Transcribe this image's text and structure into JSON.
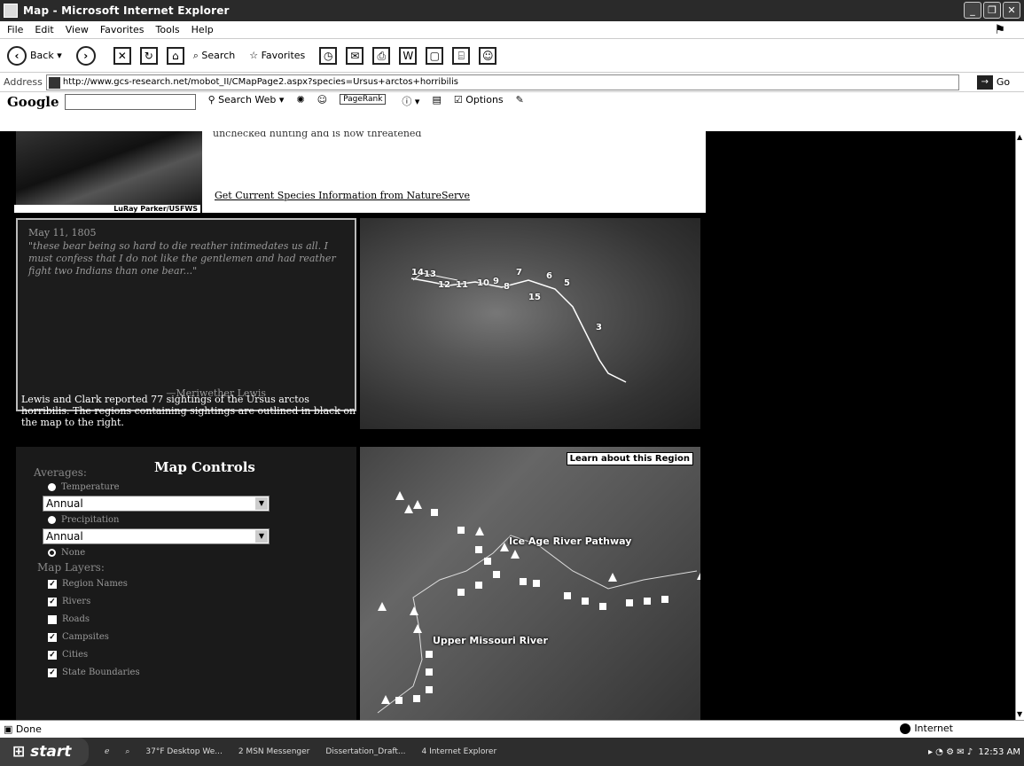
{
  "window": {
    "title": "Map - Microsoft Internet Explorer"
  },
  "menu": [
    "File",
    "Edit",
    "View",
    "Favorites",
    "Tools",
    "Help"
  ],
  "toolbar": {
    "back_label": "Back",
    "search_label": "Search",
    "favorites_label": "Favorites"
  },
  "address": {
    "label": "Address",
    "url": "http://www.gcs-research.net/mobot_II/CMapPage2.aspx?species=Ursus+arctos+horribilis",
    "go_label": "Go"
  },
  "google": {
    "logo": "Google",
    "search_web": "Search Web",
    "pagerank": "PageRank",
    "options": "Options"
  },
  "content": {
    "photo_credit": "LuRay Parker/USFWS",
    "species_truncated": "unchecked hunting and is now threatened",
    "species_link": "Get Current Species Information from NatureServe",
    "quote": {
      "date": "May 11, 1805",
      "text": "\"these bear being so hard to die reather intimedates us all. I must confess that I do not like the gentlemen and had reather fight two Indians than one bear...\"",
      "author": "—Meriwether Lewis"
    },
    "sightings_text": "Lewis and Clark reported 77 sightings of the Ursus arctos horribilis. The regions containing sightings are outlined in black on the map to the right.",
    "map_numbers": [
      "14",
      "13",
      "12",
      "11",
      "10",
      "9",
      "8",
      "7",
      "6",
      "5",
      "15",
      "3"
    ],
    "controls": {
      "title": "Map Controls",
      "averages_label": "Averages:",
      "temperature": "Temperature",
      "temp_select": "Annual",
      "precipitation": "Precipitation",
      "precip_select": "Annual",
      "none": "None",
      "layers_label": "Map Layers:",
      "layers": [
        "Region Names",
        "Rivers",
        "Roads",
        "Campsites",
        "Cities",
        "State Boundaries"
      ]
    },
    "map_bottom": {
      "learn_button": "Learn about this Region",
      "region1": "Ice Age River Pathway",
      "region2": "Upper Missouri River"
    }
  },
  "status": {
    "text": "Done",
    "zone": "Internet"
  },
  "taskbar": {
    "start": "start",
    "tasks": [
      "37°F Desktop We...",
      "2 MSN Messenger",
      "Dissertation_Draft...",
      "4 Internet Explorer"
    ],
    "clock": "12:53 AM"
  }
}
